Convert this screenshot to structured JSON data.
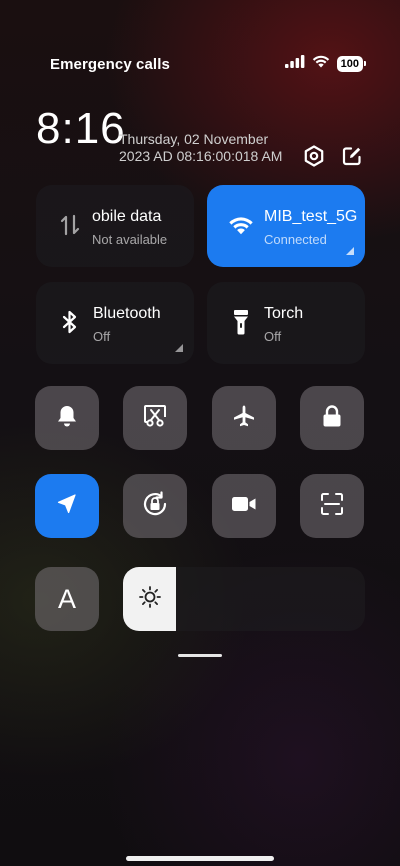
{
  "status_bar": {
    "carrier_text": "Emergency calls",
    "battery": "100",
    "signal_icon": "signal-bars-icon",
    "wifi_icon": "wifi-icon"
  },
  "header": {
    "time": "8:16",
    "date_line1": "Thursday, 02 November",
    "date_line2": "2023 AD 08:16:00:018 AM",
    "settings_icon": "gear-icon",
    "edit_icon": "edit-icon"
  },
  "tiles": {
    "mobile_data": {
      "title": "obile data",
      "subtitle": "Not available",
      "active": false
    },
    "wifi": {
      "title": "MIB_test_5G",
      "subtitle": "Connected",
      "active": true
    },
    "bluetooth": {
      "title": "Bluetooth",
      "subtitle": "Off",
      "active": false
    },
    "torch": {
      "title": "Torch",
      "subtitle": "Off",
      "active": false
    }
  },
  "toggles_row1": [
    "bell-icon",
    "screenshot-icon",
    "airplane-icon",
    "lock-icon"
  ],
  "toggles_row2": [
    "location-icon",
    "rotation-lock-icon",
    "video-icon",
    "scan-icon"
  ],
  "auto_text": {
    "label": "A"
  },
  "brightness": {
    "level": 0.22
  },
  "colors": {
    "accent": "#1c7bf0",
    "tile_bg": "#5a565a"
  }
}
